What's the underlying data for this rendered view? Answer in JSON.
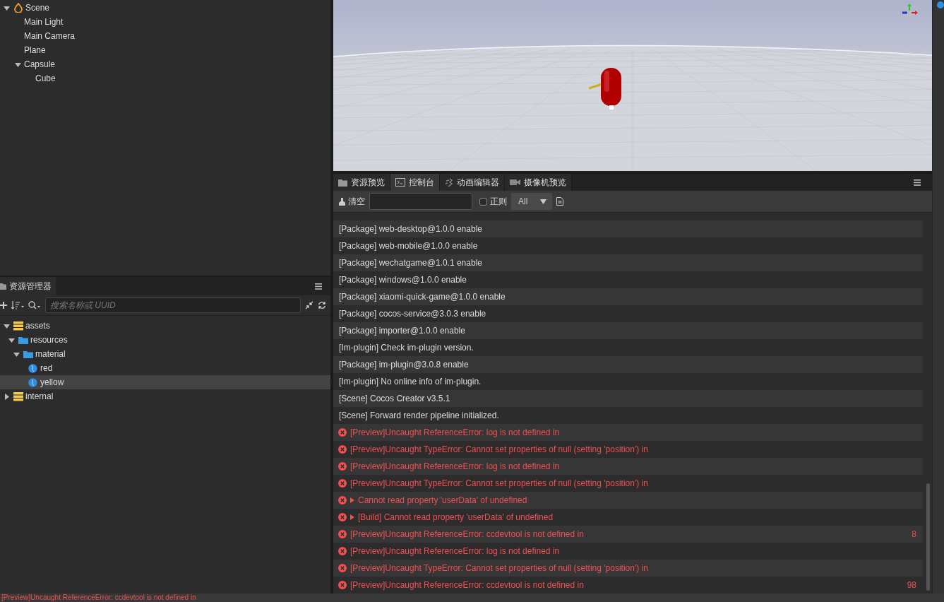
{
  "hierarchy": {
    "nodes": [
      {
        "label": "Scene",
        "kind": "scene",
        "expanded": true,
        "selected": false,
        "children": [
          {
            "label": "Main Light",
            "selected": false
          },
          {
            "label": "Main Camera",
            "selected": false
          },
          {
            "label": "Plane",
            "selected": false
          },
          {
            "label": "Capsule",
            "expanded": true,
            "selected": false,
            "children": [
              {
                "label": "Cube",
                "selected": false
              }
            ]
          }
        ]
      }
    ]
  },
  "assets": {
    "tab": "资源管理器",
    "search": {
      "placeholder": "搜索名称或 UUID"
    },
    "nodes": [
      {
        "label": "assets",
        "kind": "db",
        "expanded": true,
        "selected": false,
        "children": [
          {
            "label": "resources",
            "kind": "folder",
            "expanded": true,
            "selected": false,
            "children": [
              {
                "label": "material",
                "kind": "folder",
                "expanded": true,
                "selected": false,
                "children": [
                  {
                    "label": "red",
                    "kind": "material",
                    "selected": false
                  },
                  {
                    "label": "yellow",
                    "kind": "material",
                    "selected": true
                  }
                ]
              }
            ]
          }
        ]
      },
      {
        "label": "internal",
        "kind": "db",
        "expanded": false,
        "selected": false
      }
    ]
  },
  "console": {
    "tabs": [
      {
        "label": "资源预览",
        "kind": "folder",
        "selected": false
      },
      {
        "label": "控制台",
        "kind": "terminal",
        "selected": true
      },
      {
        "label": "动画编辑器",
        "kind": "animation",
        "selected": false
      },
      {
        "label": "摄像机预览",
        "kind": "camera",
        "selected": false
      }
    ],
    "toolbar": {
      "clear": "清空",
      "regex": {
        "label": "正则",
        "checked": false
      },
      "level_filter": "All"
    },
    "logs": [
      {
        "kind": "info",
        "text": "[Package] web-desktop@1.0.0 enable",
        "expander": false
      },
      {
        "kind": "info",
        "text": "[Package] web-mobile@1.0.0 enable",
        "expander": false
      },
      {
        "kind": "info",
        "text": "[Package] wechatgame@1.0.1 enable",
        "expander": false
      },
      {
        "kind": "info",
        "text": "[Package] windows@1.0.0 enable",
        "expander": false
      },
      {
        "kind": "info",
        "text": "[Package] xiaomi-quick-game@1.0.0 enable",
        "expander": false
      },
      {
        "kind": "info",
        "text": "[Package] cocos-service@3.0.3 enable",
        "expander": false
      },
      {
        "kind": "info",
        "text": "[Package] importer@1.0.0 enable",
        "expander": false
      },
      {
        "kind": "info",
        "text": "[Im-plugin] Check im-plugin version.",
        "expander": false
      },
      {
        "kind": "info",
        "text": "[Package] im-plugin@3.0.8 enable",
        "expander": false
      },
      {
        "kind": "info",
        "text": "[Im-plugin] No online info of im-plugin.",
        "expander": false
      },
      {
        "kind": "info",
        "text": "[Scene] Cocos Creator v3.5.1",
        "expander": false
      },
      {
        "kind": "info",
        "text": "[Scene] Forward render pipeline initialized.",
        "expander": false
      },
      {
        "kind": "error",
        "text": "[Preview]Uncaught ReferenceError: log is not defined in",
        "expander": false
      },
      {
        "kind": "error",
        "text": "[Preview]Uncaught TypeError: Cannot set properties of null (setting 'position') in",
        "expander": false
      },
      {
        "kind": "error",
        "text": "[Preview]Uncaught ReferenceError: log is not defined in",
        "expander": false
      },
      {
        "kind": "error",
        "text": "[Preview]Uncaught TypeError: Cannot set properties of null (setting 'position') in",
        "expander": false
      },
      {
        "kind": "error",
        "text": "Cannot read property 'userData' of undefined",
        "expander": true
      },
      {
        "kind": "error",
        "text": "[Build] Cannot read property 'userData' of undefined",
        "expander": true
      },
      {
        "kind": "error",
        "text": "[Preview]Uncaught ReferenceError: ccdevtool is not defined in",
        "expander": false,
        "count": "8"
      },
      {
        "kind": "error",
        "text": "[Preview]Uncaught ReferenceError: log is not defined in",
        "expander": false
      },
      {
        "kind": "error",
        "text": "[Preview]Uncaught TypeError: Cannot set properties of null (setting 'position') in",
        "expander": false
      },
      {
        "kind": "error",
        "text": "[Preview]Uncaught ReferenceError: ccdevtool is not defined in",
        "expander": false,
        "count": "98"
      }
    ]
  },
  "status_bar": {
    "message": "[Preview]Uncaught ReferenceError: ccdevtool is not defined in"
  }
}
